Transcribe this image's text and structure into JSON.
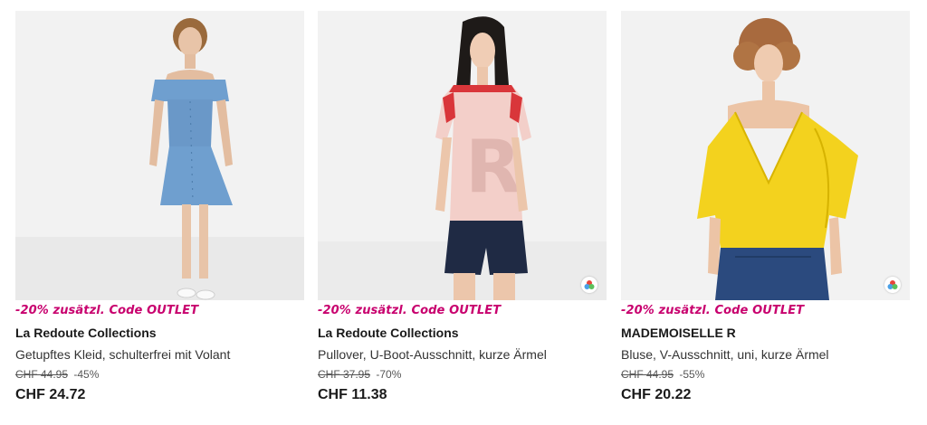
{
  "products": [
    {
      "promo": "-20% zusätzl. Code OUTLET",
      "brand": "La Redoute Collections",
      "description": "Getupftes Kleid, schulterfrei mit Volant",
      "old_price": "CHF 44.95",
      "discount": "-45%",
      "price": "CHF 24.72",
      "image": "model-blue-off-shoulder-dress",
      "has_color_icon": false
    },
    {
      "promo": "-20% zusätzl. Code OUTLET",
      "brand": "La Redoute Collections",
      "description": "Pullover, U-Boot-Ausschnitt, kurze Ärmel",
      "old_price": "CHF 37.95",
      "discount": "-70%",
      "price": "CHF 11.38",
      "image": "model-pink-top-navy-shorts",
      "has_color_icon": true
    },
    {
      "promo": "-20% zusätzl. Code OUTLET",
      "brand": "MADEMOISELLE R",
      "description": "Bluse, V-Ausschnitt, uni, kurze Ärmel",
      "old_price": "CHF 44.95",
      "discount": "-55%",
      "price": "CHF 20.22",
      "image": "model-yellow-ruffle-blouse",
      "has_color_icon": true
    }
  ],
  "colors": {
    "promo": "#c8006e",
    "background": "#ffffff",
    "photo_bg": "#f1f1f1"
  }
}
